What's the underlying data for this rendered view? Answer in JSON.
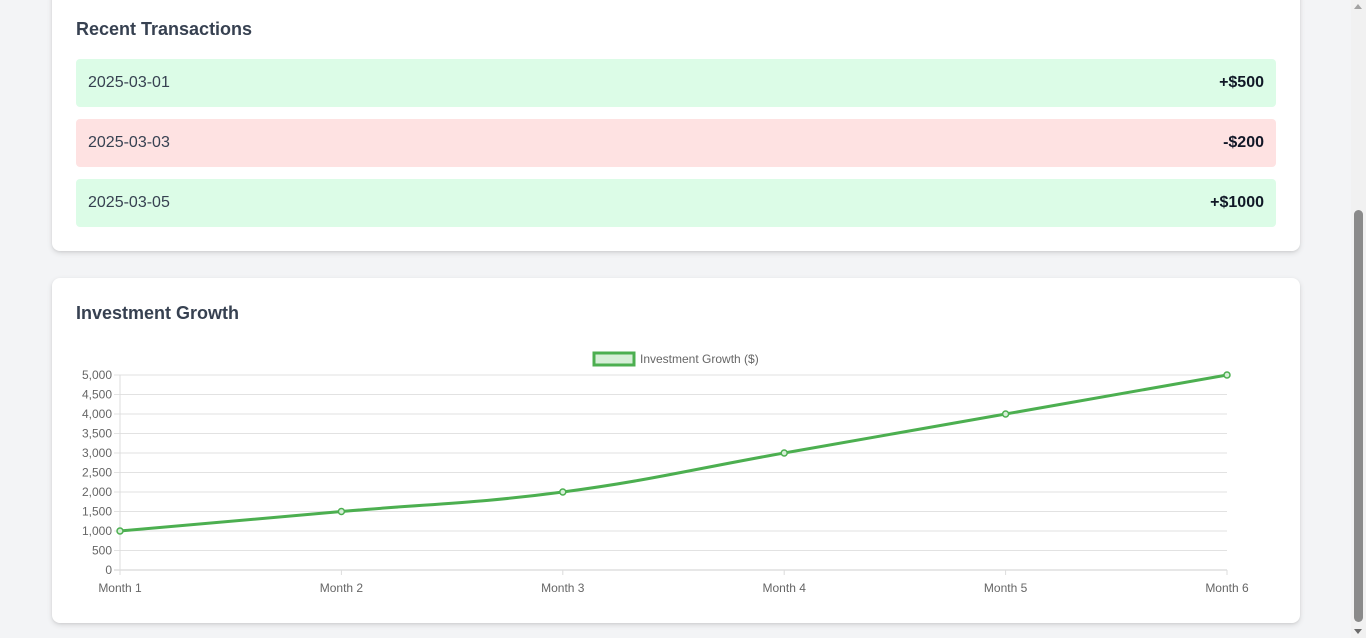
{
  "transactions": {
    "title": "Recent Transactions",
    "items": [
      {
        "date": "2025-03-01",
        "amount": "+$500",
        "kind": "credit"
      },
      {
        "date": "2025-03-03",
        "amount": "-$200",
        "kind": "debit"
      },
      {
        "date": "2025-03-05",
        "amount": "+$1000",
        "kind": "credit"
      }
    ]
  },
  "growth": {
    "title": "Investment Growth"
  },
  "colors": {
    "credit_bg": "#dcfce7",
    "debit_bg": "#fee2e2",
    "line": "#4caf50",
    "line_fill": "#d6efd7"
  },
  "chart_data": {
    "type": "line",
    "categories": [
      "Month 1",
      "Month 2",
      "Month 3",
      "Month 4",
      "Month 5",
      "Month 6"
    ],
    "series": [
      {
        "name": "Investment Growth ($)",
        "values": [
          1000,
          1500,
          2000,
          3000,
          4000,
          5000
        ]
      }
    ],
    "ylim": [
      0,
      5000
    ],
    "yticks": [
      "0",
      "500",
      "1,000",
      "1,500",
      "2,000",
      "2,500",
      "3,000",
      "3,500",
      "4,000",
      "4,500",
      "5,000"
    ],
    "legend_position": "top",
    "grid": true,
    "title": "",
    "xlabel": "",
    "ylabel": ""
  }
}
